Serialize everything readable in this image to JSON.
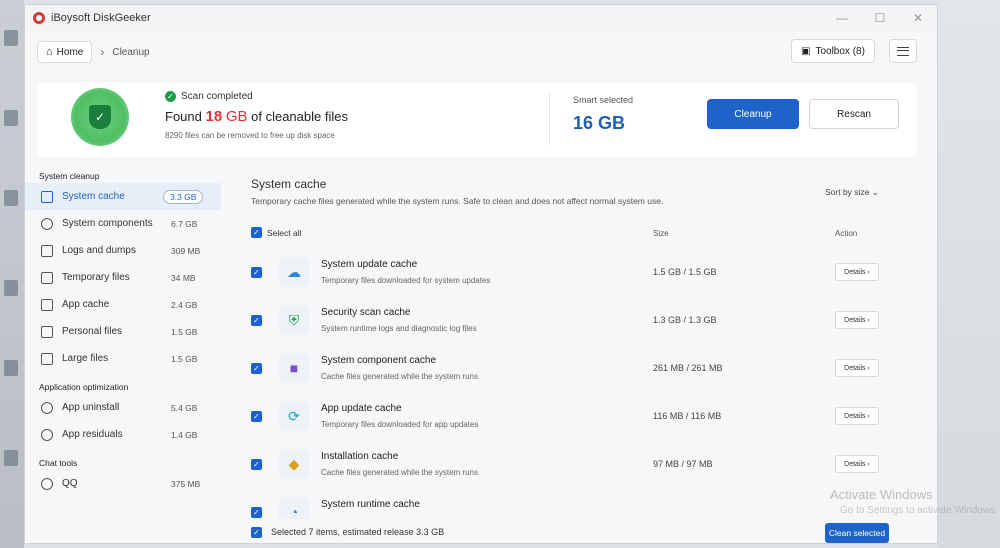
{
  "window": {
    "title": "iBoysoft DiskGeeker",
    "controls": [
      "—",
      "☐",
      "✕"
    ]
  },
  "nav": {
    "home_label": "Home",
    "crumb": "Cleanup",
    "toolbox_label": "Toolbox (8)"
  },
  "summary": {
    "status": "Scan completed",
    "found_prefix": "Found",
    "found_number": "18",
    "found_unit": "GB",
    "found_suffix": "of cleanable files",
    "found_sub": "8290 files can be removed to free up disk space",
    "smart_label": "Smart selected",
    "smart_value": "16 GB",
    "cleanup_label": "Cleanup",
    "rescan_label": "Rescan"
  },
  "sidebar": {
    "sections": [
      {
        "title": "System cleanup",
        "items": [
          {
            "label": "System cache",
            "size": "3.3 GB",
            "active": true
          },
          {
            "label": "System components",
            "size": "6.7 GB"
          },
          {
            "label": "Logs and dumps",
            "size": "309 MB"
          },
          {
            "label": "Temporary files",
            "size": "34 MB"
          },
          {
            "label": "App cache",
            "size": "2.4 GB"
          },
          {
            "label": "Personal files",
            "size": "1.5 GB"
          },
          {
            "label": "Large files",
            "size": "1.5 GB"
          }
        ]
      },
      {
        "title": "Application optimization",
        "items": [
          {
            "label": "App uninstall",
            "size": "5.4 GB"
          },
          {
            "label": "App residuals",
            "size": "1.4 GB"
          }
        ]
      },
      {
        "title": "Chat tools",
        "items": [
          {
            "label": "QQ",
            "size": "375 MB"
          }
        ]
      }
    ]
  },
  "main": {
    "title": "System cache",
    "desc": "Temporary cache files generated while the system runs. Safe to clean and does not affect normal system use.",
    "sort_label": "Sort by size",
    "select_all": "Select all",
    "col_size": "Size",
    "col_action": "Action",
    "details_label": "Details",
    "rows": [
      {
        "name": "System update cache",
        "desc": "Temporary files downloaded for system updates",
        "size": "1.5 GB / 1.5 GB",
        "icon": "cloud-icon",
        "color": "#2b86d9"
      },
      {
        "name": "Security scan cache",
        "desc": "System runtime logs and diagnostic log files",
        "size": "1.3 GB / 1.3 GB",
        "icon": "shield-icon",
        "color": "#1f9d45"
      },
      {
        "name": "System component cache",
        "desc": "Cache files generated while the system runs",
        "size": "261 MB / 261 MB",
        "icon": "component-icon",
        "color": "#7a4fd0"
      },
      {
        "name": "App update cache",
        "desc": "Temporary files downloaded for app updates",
        "size": "116 MB / 116 MB",
        "icon": "refresh-icon",
        "color": "#1aa6b8"
      },
      {
        "name": "Installation cache",
        "desc": "Cache files generated while the system runs",
        "size": "97 MB / 97 MB",
        "icon": "package-icon",
        "color": "#d9a21b"
      },
      {
        "name": "System runtime cache",
        "desc": "",
        "size": "",
        "icon": "gauge-icon",
        "color": "#2b86d9"
      }
    ],
    "footer_text": "Selected 7 items, estimated release 3.3 GB",
    "clean_selected": "Clean selected"
  },
  "watermark": {
    "line1": "Activate Windows",
    "line2": "Go to Settings to activate Windows"
  }
}
